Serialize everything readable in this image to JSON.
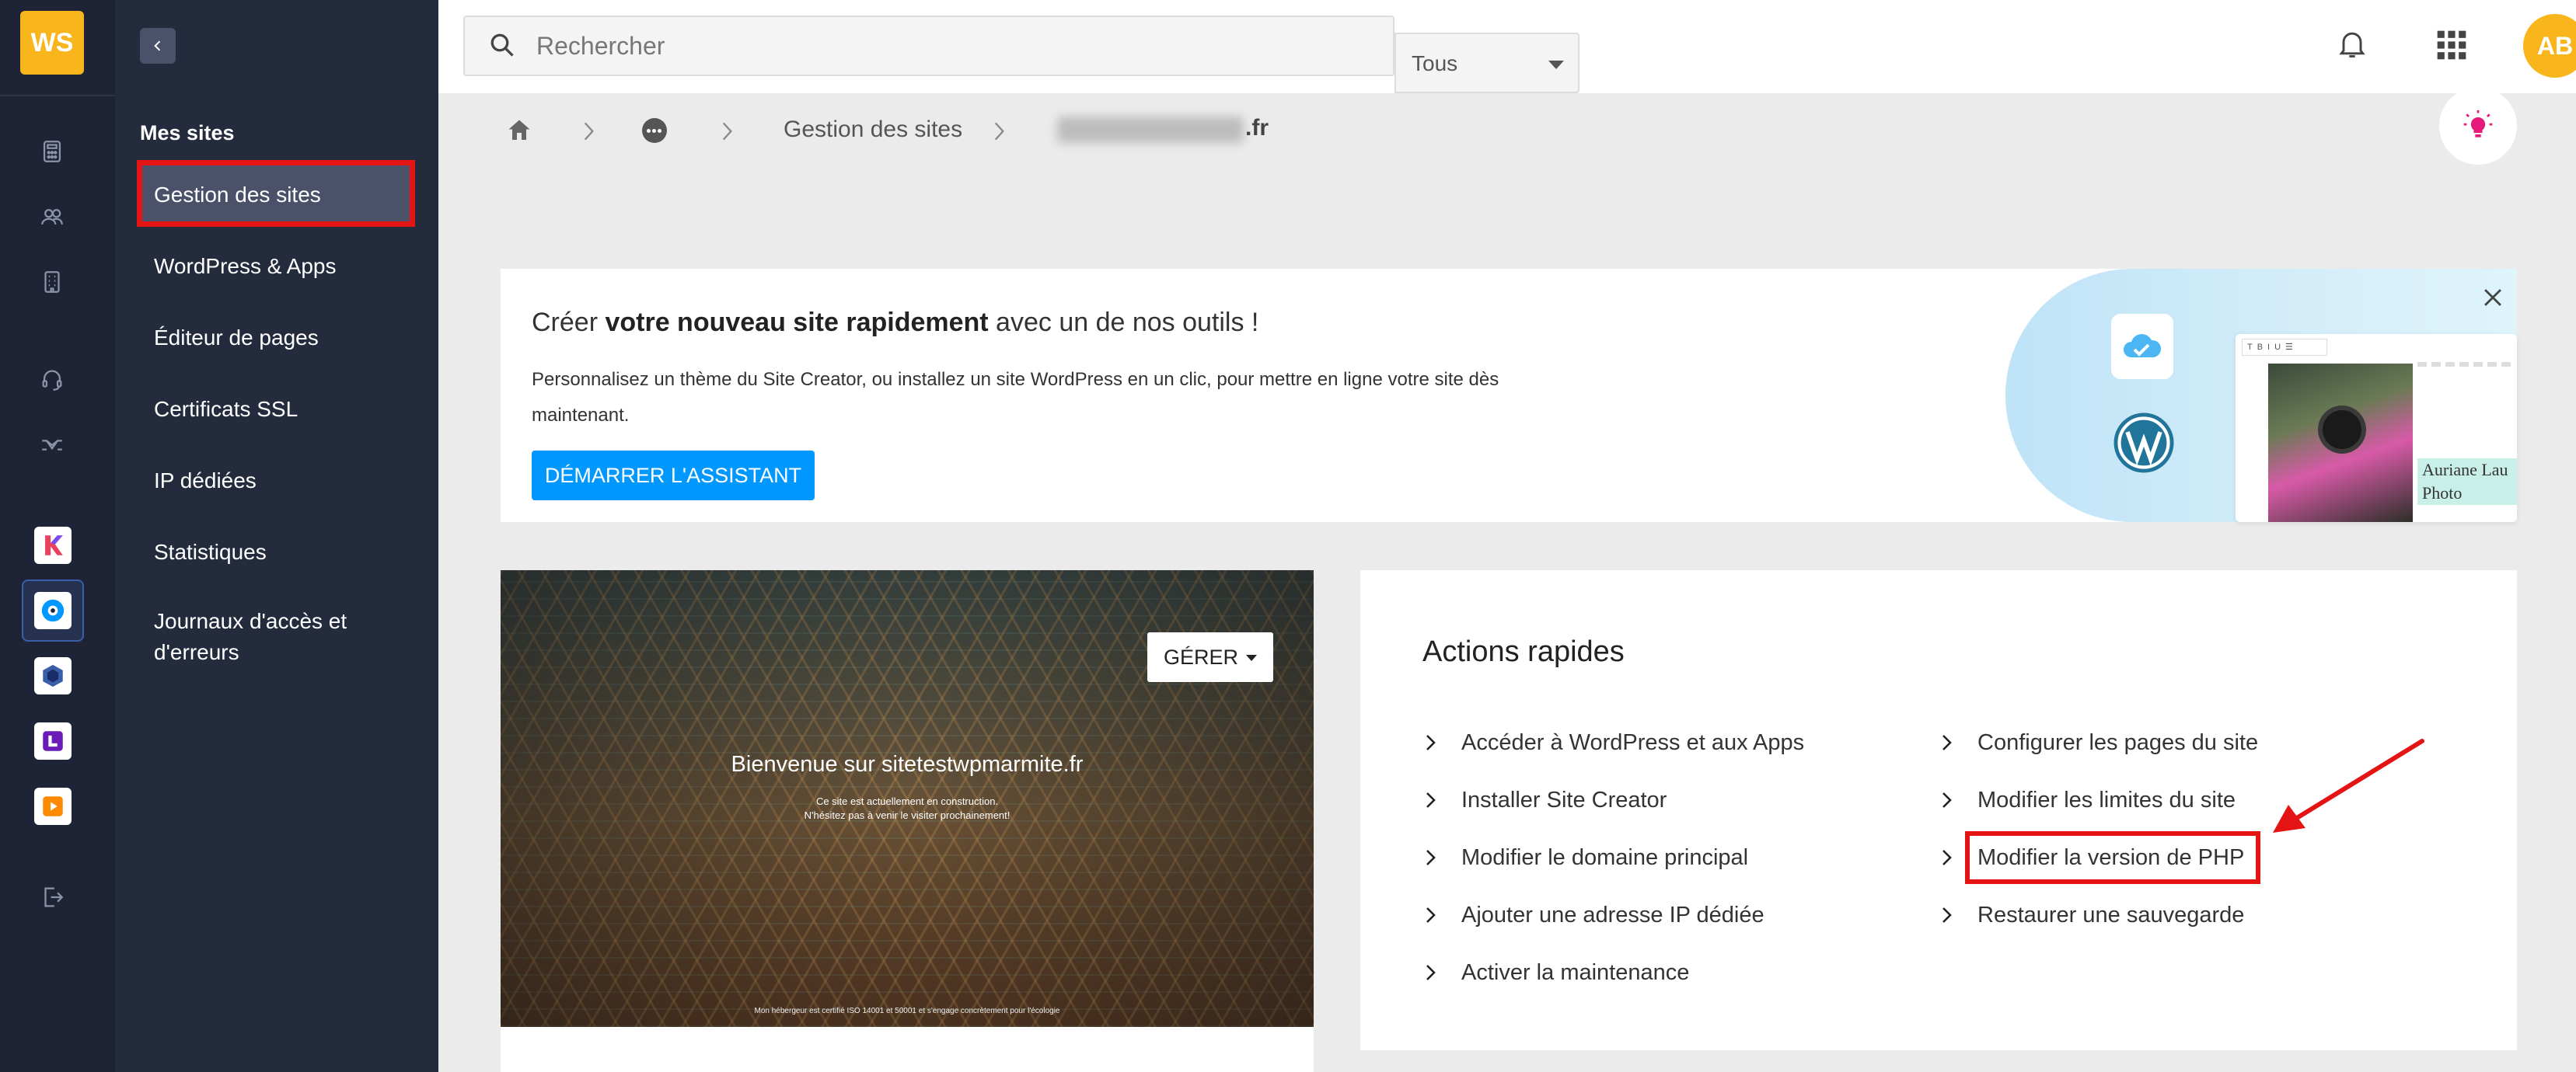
{
  "brand": {
    "logo_text": "WS",
    "accent": "#f8b51c"
  },
  "rail": {
    "icons": [
      "calculator-icon",
      "users-icon",
      "building-icon",
      "headset-icon",
      "handshake-icon",
      "logout-icon"
    ],
    "apps": [
      "kchat-app",
      "kdrive-app",
      "kmeet-app",
      "ksuite-app",
      "swisstransfer-app"
    ]
  },
  "nav": {
    "section_title": "Mes sites",
    "items": [
      {
        "label": "Gestion des sites",
        "active": true
      },
      {
        "label": "WordPress & Apps"
      },
      {
        "label": "Éditeur de pages"
      },
      {
        "label": "Certificats SSL"
      },
      {
        "label": "IP dédiées"
      },
      {
        "label": "Statistiques"
      },
      {
        "label": "Journaux d'accès et d'erreurs"
      }
    ]
  },
  "search": {
    "placeholder": "Rechercher",
    "filter": "Tous"
  },
  "user": {
    "initials": "AB"
  },
  "breadcrumb": {
    "section": "Gestion des sites",
    "domain": ".fr"
  },
  "banner": {
    "title_prefix": "Créer ",
    "title_bold": "votre nouveau site rapidement",
    "title_suffix": " avec un de nos outils !",
    "description": "Personnalisez un thème du Site Creator, ou installez un site WordPress en un clic, pour mettre en ligne votre site dès maintenant.",
    "button": "DÉMARRER L'ASSISTANT",
    "art_name": "Auriane Lau Photo"
  },
  "preview": {
    "title": "Bienvenue sur sitetestwpmarmite.fr",
    "subtitle_1": "Ce site est actuellement en construction.",
    "subtitle_2": "N'hésitez pas à venir le visiter prochainement!",
    "footer": "Mon hébergeur est certifié ISO 14001 et 50001 et s'engage concrètement pour l'écologie",
    "manage_button": "GÉRER"
  },
  "quick_actions": {
    "title": "Actions rapides",
    "left": [
      "Accéder à WordPress et aux Apps",
      "Installer Site Creator",
      "Modifier le domaine principal",
      "Ajouter une adresse IP dédiée",
      "Activer la maintenance"
    ],
    "right": [
      "Configurer les pages du site",
      "Modifier les limites du site",
      "Modifier la version de PHP",
      "Restaurer une sauvegarde"
    ]
  },
  "annotation_color": "#e41414"
}
